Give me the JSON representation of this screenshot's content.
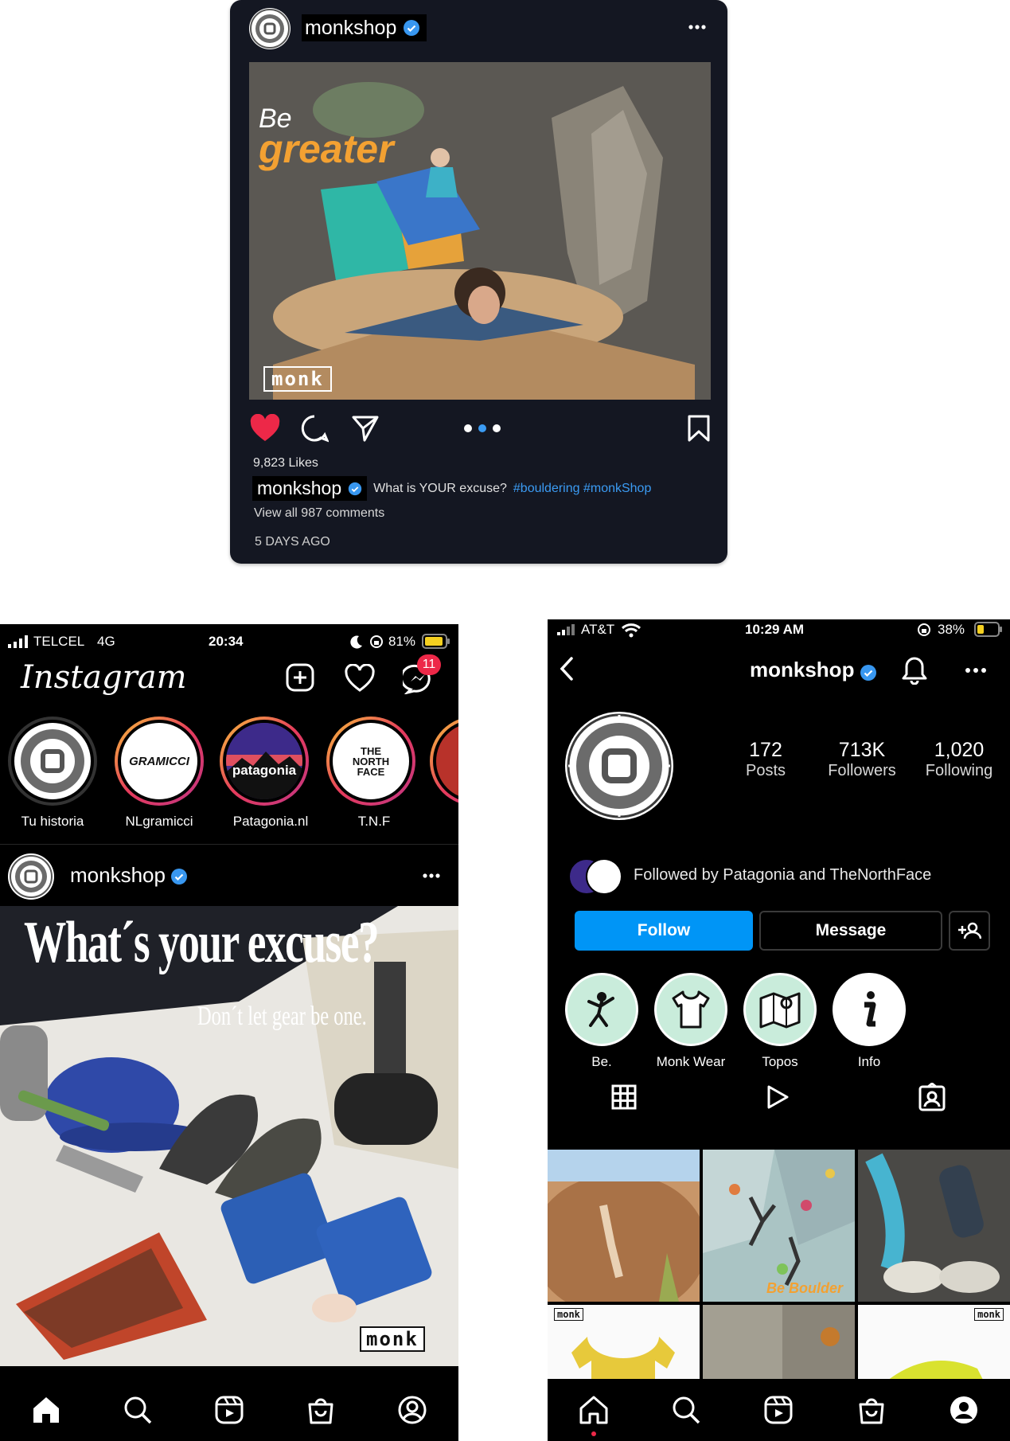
{
  "post_card": {
    "username": "monkshop",
    "photo_text_1": "Be",
    "photo_text_2": "greater",
    "watermark": "monk",
    "likes": "9,823 Likes",
    "caption_user": "monkshop",
    "caption_text": "What is YOUR excuse?",
    "caption_tags": "#bouldering #monkShop",
    "view_comments": "View all 987 comments",
    "time_ago": "5 DAYS AGO"
  },
  "left_phone": {
    "status": {
      "carrier": "TELCEL",
      "network": "4G",
      "time": "20:34",
      "battery": "81%"
    },
    "app_title": "Instagram",
    "messages_badge": "11",
    "stories": [
      {
        "label": "Tu historia",
        "logo": "monk"
      },
      {
        "label": "NLgramicci",
        "logo": "GRAMICCI"
      },
      {
        "label": "Patagonia.nl",
        "logo": "patagonia"
      },
      {
        "label": "T.N.F",
        "logo": "THE NORTH FACE"
      }
    ],
    "post": {
      "username": "monkshop",
      "headline": "What´s your excuse?",
      "subline": "Don´t let gear be one.",
      "watermark": "monk"
    }
  },
  "right_phone": {
    "status": {
      "carrier": "AT&T",
      "time": "10:29 AM",
      "battery": "38%"
    },
    "username": "monkshop",
    "stats": [
      {
        "value": "172",
        "label": "Posts"
      },
      {
        "value": "713K",
        "label": "Followers"
      },
      {
        "value": "1,020",
        "label": "Following"
      }
    ],
    "followed_by": "Followed by Patagonia and TheNorthFace",
    "follow_button": "Follow",
    "message_button": "Message",
    "highlights": [
      {
        "label": "Be.",
        "icon": "climber-icon"
      },
      {
        "label": "Monk Wear",
        "icon": "tshirt-icon"
      },
      {
        "label": "Topos",
        "icon": "map-icon"
      },
      {
        "label": "Info",
        "icon": "info-icon"
      }
    ],
    "grid_overlay_text": "Be Boulder",
    "grid_watermark": "monk"
  },
  "colors": {
    "instagram_blue": "#0095f6",
    "like_red": "#ed2848",
    "card_bg": "#141722",
    "verified_blue": "#3897f0",
    "greater_orange": "#f3a132"
  }
}
